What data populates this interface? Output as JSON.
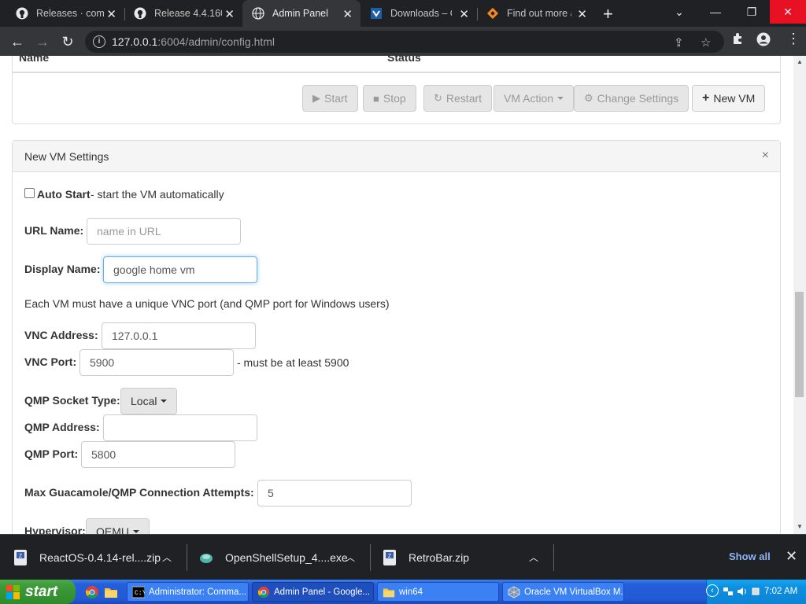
{
  "browser": {
    "tabs": [
      {
        "title": "Releases · comp",
        "icon": "github-icon"
      },
      {
        "title": "Release 4.4.160",
        "icon": "github-icon"
      },
      {
        "title": "Admin Panel",
        "icon": "globe-icon"
      },
      {
        "title": "Downloads – Or",
        "icon": "virtualbox-icon"
      },
      {
        "title": "Find out more a",
        "icon": "diamond-icon"
      }
    ],
    "url_host": "127.0.0.1",
    "url_rest": ":6004/admin/config.html"
  },
  "vm_list": {
    "col_name": "Name",
    "col_status": "Status",
    "buttons": {
      "start": "Start",
      "stop": "Stop",
      "restart": "Restart",
      "vm_action": "VM Action",
      "change_settings": "Change Settings",
      "new_vm": "New VM"
    }
  },
  "settings": {
    "title": "New VM Settings",
    "close": "×",
    "auto_start_label": "Auto Start",
    "auto_start_desc": " - start the VM automatically",
    "url_name_label": "URL Name:",
    "url_name_placeholder": "name in URL",
    "url_name_value": "",
    "display_name_label": "Display Name:",
    "display_name_value": "google home vm",
    "vnc_note": "Each VM must have a unique VNC port (and QMP port for Windows users)",
    "vnc_address_label": "VNC Address:",
    "vnc_address_value": "127.0.0.1",
    "vnc_port_label": "VNC Port:",
    "vnc_port_value": "5900",
    "vnc_port_note": "- must be at least 5900",
    "qmp_socket_label": "QMP Socket Type:",
    "qmp_socket_value": "Local",
    "qmp_address_label": "QMP Address:",
    "qmp_address_value": "",
    "qmp_port_label": "QMP Port:",
    "qmp_port_value": "5800",
    "max_attempts_label": "Max Guacamole/QMP Connection Attempts:",
    "max_attempts_value": "5",
    "hypervisor_label": "Hypervisor:",
    "hypervisor_value": "QEMU"
  },
  "downloads": {
    "items": [
      {
        "name": "ReactOS-0.4.14-rel....zip",
        "icon": "zip-icon"
      },
      {
        "name": "OpenShellSetup_4....exe",
        "icon": "shell-icon"
      },
      {
        "name": "RetroBar.zip",
        "icon": "zip-icon"
      }
    ],
    "show_all": "Show all"
  },
  "taskbar": {
    "start": "start",
    "tasks": [
      {
        "label": "Administrator: Comma...",
        "icon": "cmd-icon"
      },
      {
        "label": "Admin Panel - Google...",
        "icon": "chrome-icon"
      },
      {
        "label": "win64",
        "icon": "folder-icon"
      },
      {
        "label": "Oracle VM VirtualBox M...",
        "icon": "virtualbox-icon"
      }
    ],
    "clock": "7:02 AM"
  },
  "colors": {
    "chrome_dark": "#202124",
    "chrome_toolbar": "#35363a",
    "xp_blue": "#245edb",
    "xp_green": "#3c9a39",
    "link_blue": "#8ab4f8"
  }
}
